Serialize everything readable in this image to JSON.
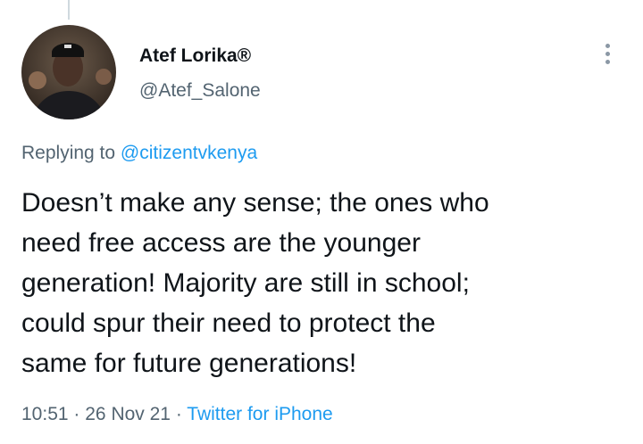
{
  "tweet": {
    "author": {
      "display_name": "Atef Lorika®",
      "handle": "@Atef_Salone",
      "avatar_icon": "profile-photo"
    },
    "more_icon": "more-vertical-icon",
    "replying_prefix": "Replying to",
    "replying_to": "@citizentvkenya",
    "text": "Doesn’t make any sense; the ones who\nneed free access are the younger\ngeneration! Majority are still in school;\ncould spur their need to protect the\nsame for future generations!",
    "time": "10:51",
    "separator": "·",
    "date": "26 Nov 21",
    "source": "Twitter for iPhone"
  },
  "colors": {
    "text_primary": "#0f1419",
    "text_secondary": "#536471",
    "link": "#1d9bf0"
  }
}
